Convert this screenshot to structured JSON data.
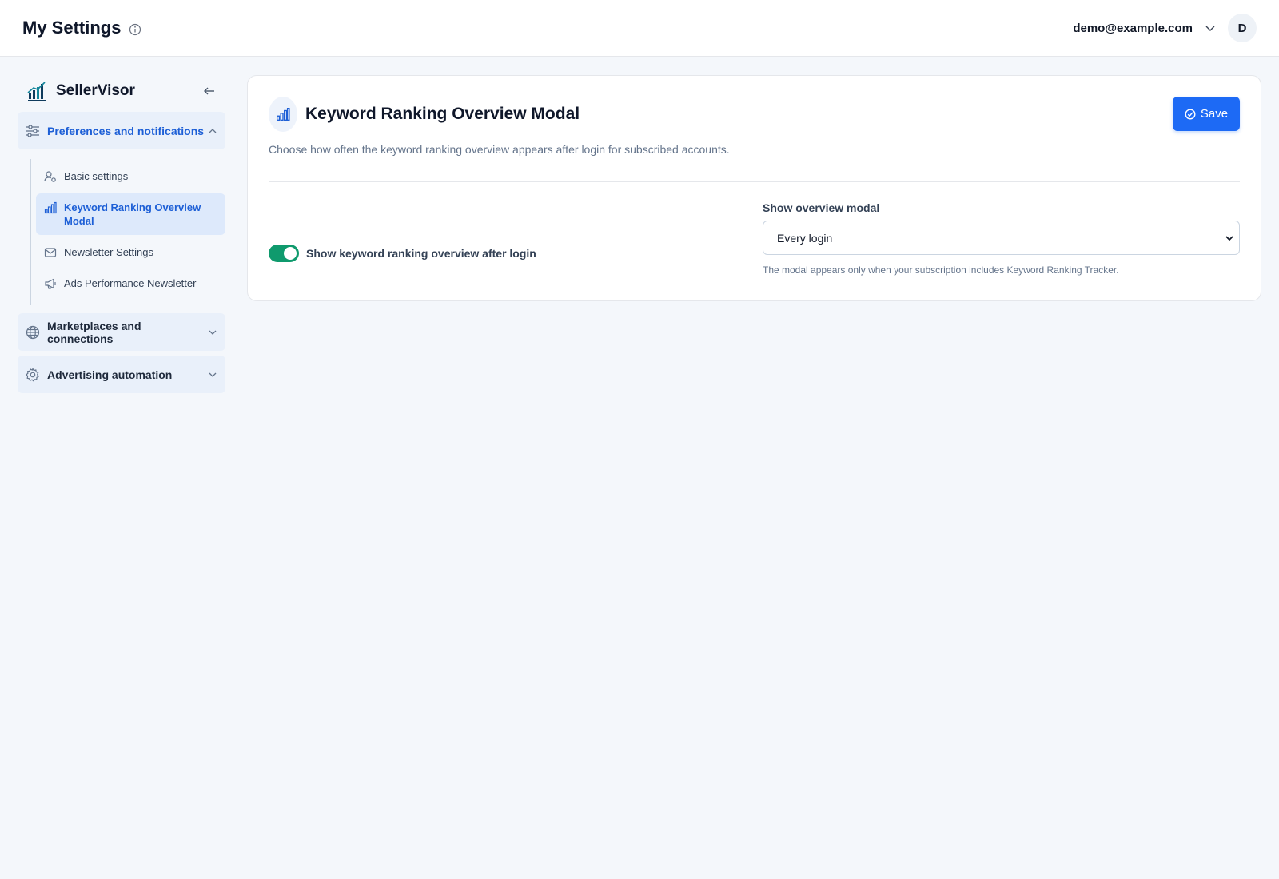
{
  "header": {
    "title": "My Settings",
    "user_email": "demo@example.com",
    "avatar_initial": "D"
  },
  "sidebar": {
    "brand_name": "SellerVisor",
    "groups": [
      {
        "label": "Preferences and notifications",
        "icon": "sliders-icon",
        "expanded": true,
        "items": [
          {
            "label": "Basic settings",
            "icon": "user-gear-icon",
            "active": false
          },
          {
            "label": "Keyword Ranking Overview Modal",
            "icon": "bar-chart-icon",
            "active": true
          },
          {
            "label": "Newsletter Settings",
            "icon": "mail-icon",
            "active": false
          },
          {
            "label": "Ads Performance Newsletter",
            "icon": "megaphone-icon",
            "active": false
          }
        ]
      },
      {
        "label": "Marketplaces and connections",
        "icon": "globe-icon",
        "expanded": false
      },
      {
        "label": "Advertising automation",
        "icon": "gear-icon",
        "expanded": false
      }
    ]
  },
  "main": {
    "title": "Keyword Ranking Overview Modal",
    "description": "Choose how often the keyword ranking overview appears after login for subscribed accounts.",
    "save_label": "Save",
    "toggle": {
      "label": "Show keyword ranking overview after login",
      "enabled": true
    },
    "select": {
      "label": "Show overview modal",
      "value": "Every login",
      "help": "The modal appears only when your subscription includes Keyword Ranking Tracker."
    }
  },
  "colors": {
    "accent": "#1d6af5",
    "active_text": "#1d5fd6",
    "toggle_on": "#0f9a6d",
    "background": "#f4f7fb"
  }
}
